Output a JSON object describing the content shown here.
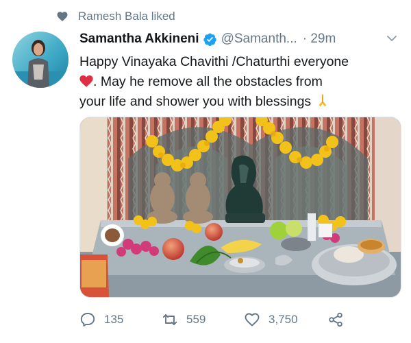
{
  "social_context": {
    "text": "Ramesh Bala liked",
    "icon": "heart-icon"
  },
  "tweet": {
    "author_name": "Samantha Akkineni",
    "handle": "@Samanth...",
    "time": "· 29m",
    "text_line1": "Happy Vinayaka Chavithi /Chaturthi  everyone",
    "text_line2": ". May he remove all the obstacles from",
    "text_line3": "your life and shower you with blessings"
  },
  "actions": {
    "replies": "135",
    "retweets": "559",
    "likes": "3,750"
  },
  "colors": {
    "accent": "#1da1f2",
    "secondary_text": "#657786",
    "heart_emoji": "#dd2e44"
  }
}
